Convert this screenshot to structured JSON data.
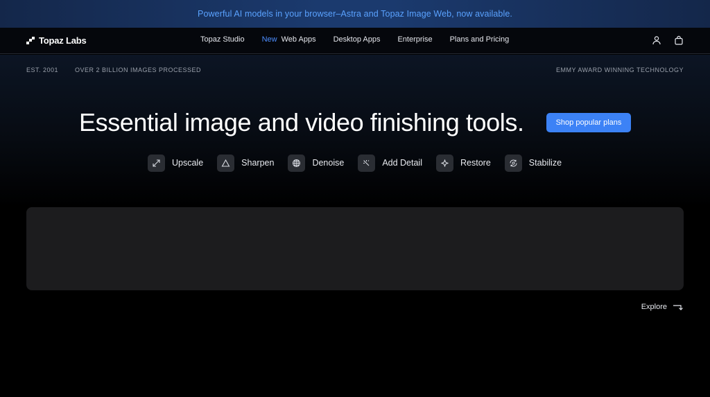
{
  "banner": {
    "text": "Powerful AI models in your browser–Astra and Topaz Image Web, now available."
  },
  "navbar": {
    "logo_text": "Topaz Labs",
    "links": [
      {
        "label": "Topaz Studio"
      },
      {
        "badge": "New",
        "label": "Web Apps"
      },
      {
        "label": "Desktop Apps"
      },
      {
        "label": "Enterprise"
      },
      {
        "label": "Plans and Pricing"
      }
    ],
    "icons": [
      "account-icon",
      "cart-icon"
    ]
  },
  "meta": {
    "established": "EST. 2001",
    "processed": "OVER 2 BILLION IMAGES PROCESSED",
    "award": "EMMY AWARD WINNING TECHNOLOGY"
  },
  "hero": {
    "headline": "Essential image and video finishing tools.",
    "cta_label": "Shop popular plans"
  },
  "features": [
    {
      "label": "Upscale",
      "icon": "expand-arrows-icon"
    },
    {
      "label": "Sharpen",
      "icon": "triangle-icon"
    },
    {
      "label": "Denoise",
      "icon": "globe-grid-icon"
    },
    {
      "label": "Add Detail",
      "icon": "magic-wand-icon"
    },
    {
      "label": "Restore",
      "icon": "sparkle-icon"
    },
    {
      "label": "Stabilize",
      "icon": "stabilize-icon"
    }
  ],
  "explore": {
    "label": "Explore",
    "icon": "arrow-down-right-icon"
  },
  "colors": {
    "banner_text": "#5aa2ff",
    "accent": "#3c82f6",
    "new_badge": "#4c8dff",
    "background": "#000000",
    "panel": "#1c1c1e"
  }
}
